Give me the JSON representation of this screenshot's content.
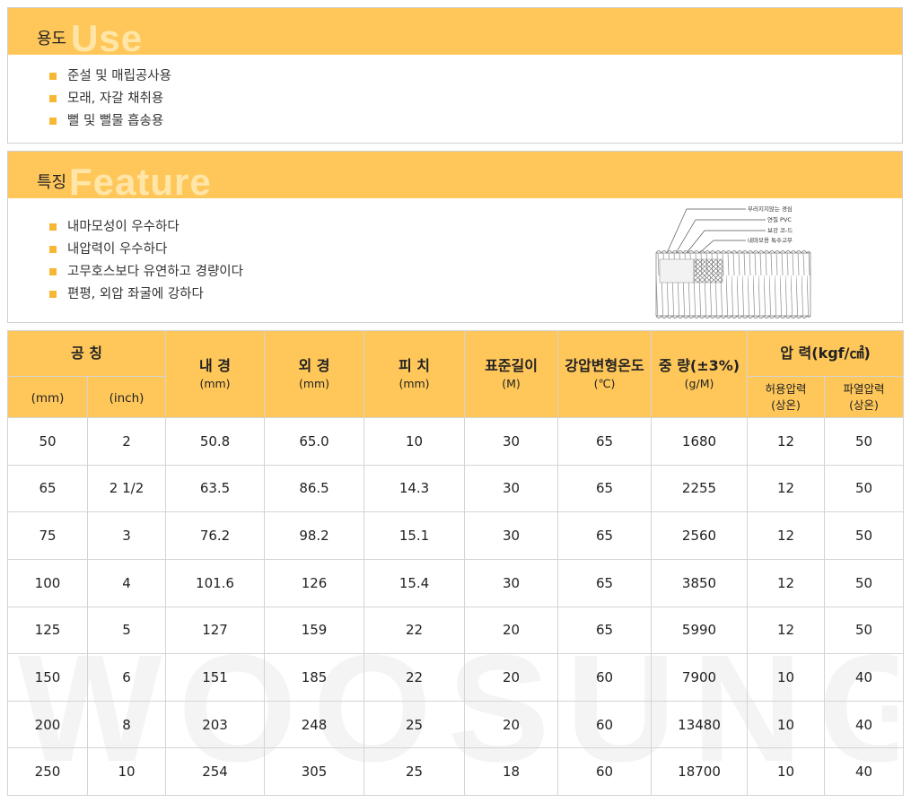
{
  "usage": {
    "title_kr": "용도",
    "title_en": "Use",
    "items": [
      "준설 및 매립공사용",
      "모래, 자갈 채취용",
      "뻘 및 뻘물 흡송용"
    ]
  },
  "feature": {
    "title_kr": "특징",
    "title_en": "Feature",
    "items": [
      "내마모성이 우수하다",
      "내압력이 우수하다",
      "고무호스보다 유연하고 경량이다",
      "편평, 외압 좌굴에 강하다"
    ],
    "diagram_labels": [
      "부러지지않는 경심",
      "연질 PVC",
      "보강 코-드",
      "내마모용 특수고무"
    ]
  },
  "table": {
    "headers": {
      "nominal": "공 칭",
      "mm": "(mm)",
      "inch": "(inch)",
      "inner": "내 경",
      "inner_unit": "(mm)",
      "outer": "외 경",
      "outer_unit": "(mm)",
      "pitch": "피 치",
      "pitch_unit": "(mm)",
      "length": "표준길이",
      "length_unit": "(M)",
      "temp": "강압변형온도",
      "temp_unit": "(℃)",
      "weight": "중 량(±3%)",
      "weight_unit": "(g/M)",
      "pressure": "압 력(kgf/㎠)",
      "allow": "허용압력",
      "allow_sub": "(상온)",
      "burst": "파열압력",
      "burst_sub": "(상온)"
    },
    "rows": [
      [
        "50",
        "2",
        "50.8",
        "65.0",
        "10",
        "30",
        "65",
        "1680",
        "12",
        "50"
      ],
      [
        "65",
        "2 1/2",
        "63.5",
        "86.5",
        "14.3",
        "30",
        "65",
        "2255",
        "12",
        "50"
      ],
      [
        "75",
        "3",
        "76.2",
        "98.2",
        "15.1",
        "30",
        "65",
        "2560",
        "12",
        "50"
      ],
      [
        "100",
        "4",
        "101.6",
        "126",
        "15.4",
        "30",
        "65",
        "3850",
        "12",
        "50"
      ],
      [
        "125",
        "5",
        "127",
        "159",
        "22",
        "20",
        "65",
        "5990",
        "12",
        "50"
      ],
      [
        "150",
        "6",
        "151",
        "185",
        "22",
        "20",
        "60",
        "7900",
        "10",
        "40"
      ],
      [
        "200",
        "8",
        "203",
        "248",
        "25",
        "20",
        "60",
        "13480",
        "10",
        "40"
      ],
      [
        "250",
        "10",
        "254",
        "305",
        "25",
        "18",
        "60",
        "18700",
        "10",
        "40"
      ]
    ]
  },
  "watermark": "WOOSUNG",
  "colors": {
    "accent": "#ffc75a",
    "bullet": "#f7b733",
    "ghost_text": "#ffe6a8"
  }
}
